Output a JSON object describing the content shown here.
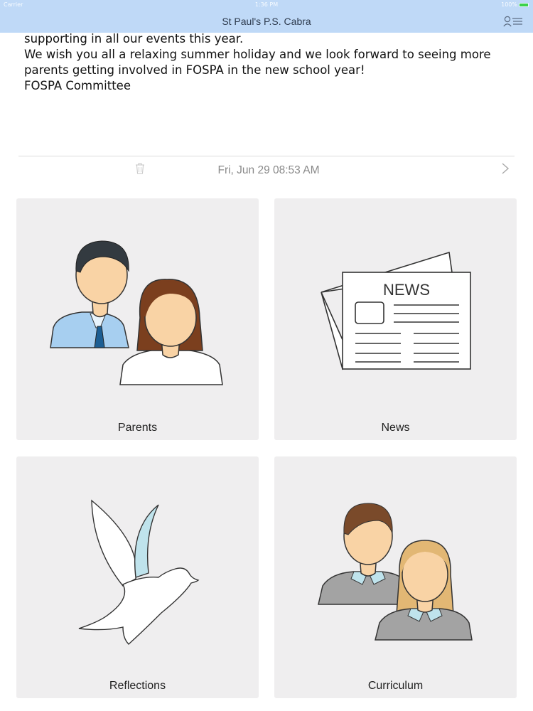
{
  "status_bar": {
    "carrier": "Carrier",
    "time": "1:36 PM",
    "battery": "100%"
  },
  "nav": {
    "title": "St Paul's P.S. Cabra",
    "menu_icon": "contacts-list-icon"
  },
  "post": {
    "lines": [
      "supporting in all our events this year.",
      "We wish you all a relaxing summer holiday and we look forward to seeing more",
      "parents getting involved in FOSPA in the new school year!",
      "FOSPA Committee"
    ],
    "date": "Fri, Jun 29 08:53 AM",
    "delete_icon": "trash-icon",
    "next_icon": "chevron-right-icon"
  },
  "tiles": [
    {
      "label": "Parents",
      "icon": "parents-icon"
    },
    {
      "label": "News",
      "icon": "newspaper-icon",
      "art_text": "NEWS"
    },
    {
      "label": "Reflections",
      "icon": "dove-icon"
    },
    {
      "label": "Curriculum",
      "icon": "students-icon"
    }
  ],
  "colors": {
    "bar_background": "#bfd9f7",
    "tile_background": "#efeeef",
    "skin": "#f9d3a5",
    "date_text": "#8a8a8a"
  }
}
